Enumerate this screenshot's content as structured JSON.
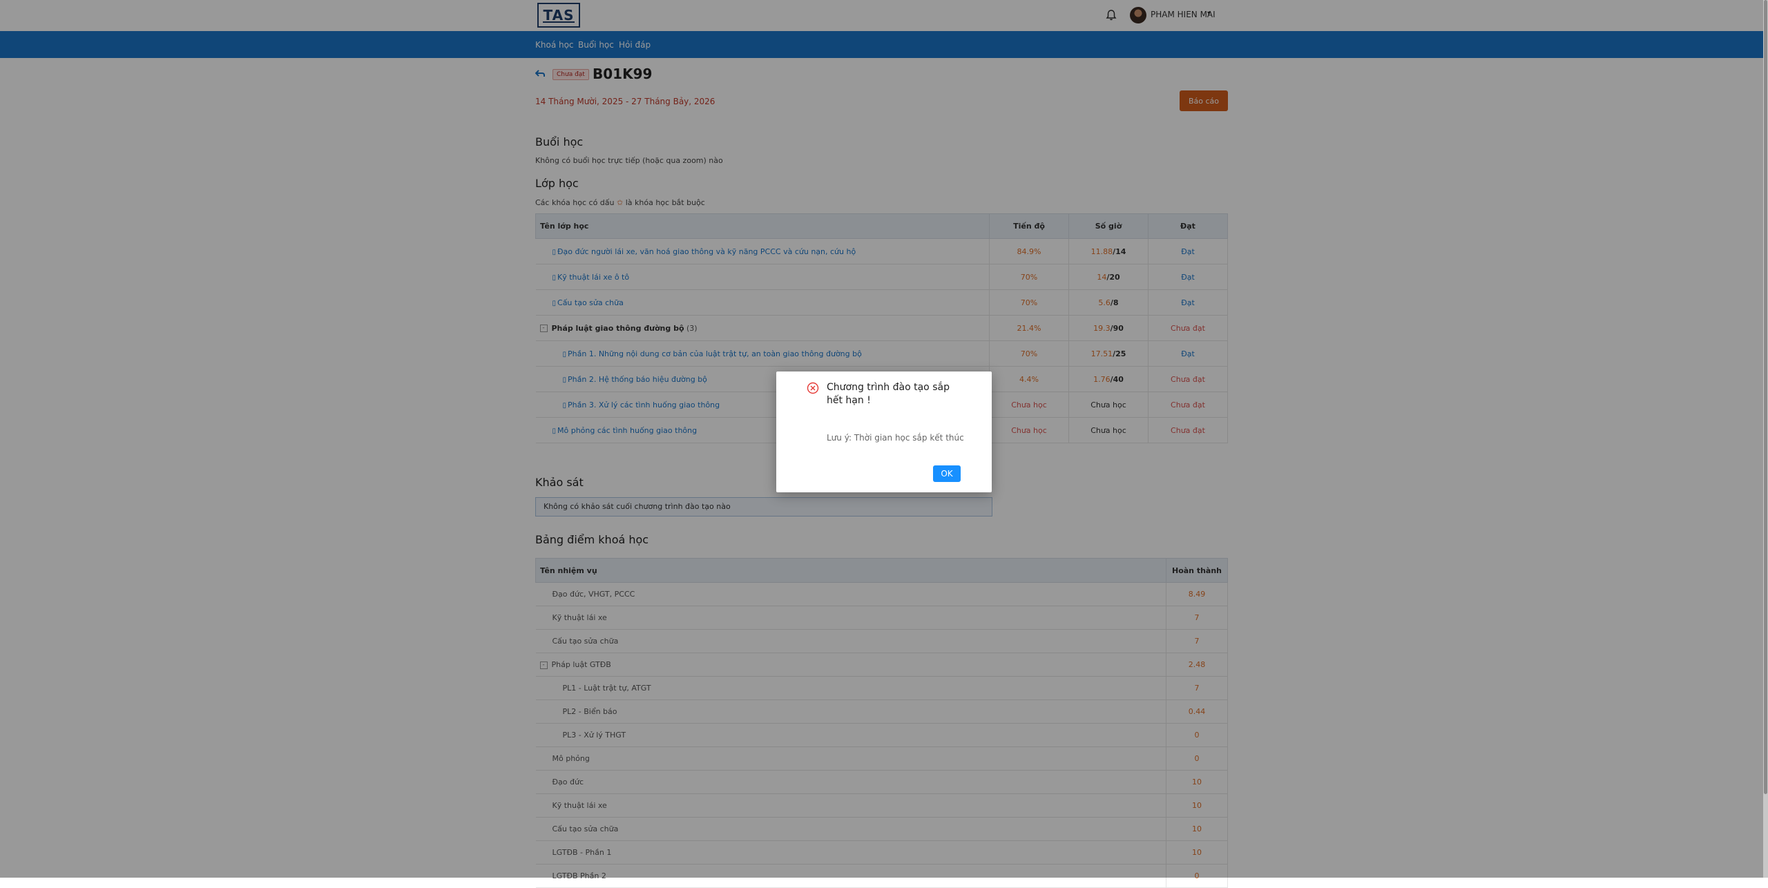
{
  "header": {
    "logo_text": "TAS",
    "user_name": "PHAM HIEN MAI",
    "caret": "▾"
  },
  "nav": {
    "items": [
      {
        "label": "Khoá học"
      },
      {
        "label": "Buổi học"
      },
      {
        "label": "Hỏi đáp"
      }
    ]
  },
  "course": {
    "status": "Chưa đạt",
    "code": "B01K99",
    "date_range": "14 Tháng Mười, 2025 - 27 Tháng Bảy, 2026",
    "report_label": "Báo cáo"
  },
  "sessions": {
    "title": "Buổi học",
    "note": "Không có buổi học trực tiếp (hoặc qua zoom) nào"
  },
  "classes": {
    "title": "Lớp học",
    "note_prefix": "Các khóa học có dấu",
    "note_mark": "✩",
    "note_suffix": "là khóa học bắt buộc",
    "headers": {
      "name": "Tên lớp học",
      "progress": "Tiến độ",
      "hours": "Số giờ",
      "passed": "Đạt"
    },
    "rows": [
      {
        "name": "Đạo đức người lái xe, văn hoá giao thông và kỹ năng PCCC và cứu nạn, cứu hộ",
        "progress": "84.9%",
        "hours_done": "11.88",
        "hours_total": "/14",
        "result": "Đạt"
      },
      {
        "name": "Kỹ thuật lái xe ô tô",
        "progress": "70%",
        "hours_done": "14",
        "hours_total": "/20",
        "result": "Đạt"
      },
      {
        "name": "Cấu tạo sửa chữa",
        "progress": "70%",
        "hours_done": "5.6",
        "hours_total": "/8",
        "result": "Đạt"
      },
      {
        "name": "Pháp luật giao thông đường bộ",
        "count": "(3)",
        "progress": "21.4%",
        "hours_done": "19.3",
        "hours_total": "/90",
        "result": "Chưa đạt"
      },
      {
        "name": "Phần 1. Những nội dung cơ bản của luật trật tự, an toàn giao thông đường bộ",
        "progress": "70%",
        "hours_done": "17.51",
        "hours_total": "/25",
        "result": "Đạt"
      },
      {
        "name": "Phần 2. Hệ thống báo hiệu đường bộ",
        "progress": "4.4%",
        "hours_done": "1.76",
        "hours_total": "/40",
        "result": "Chưa đạt"
      },
      {
        "name": "Phần 3. Xử lý các tình huống giao thông",
        "progress": "Chưa học",
        "hours": "Chưa học",
        "result": "Chưa đạt"
      },
      {
        "name": "Mô phỏng các tình huống giao thông",
        "progress": "Chưa học",
        "hours": "Chưa học",
        "result": "Chưa đạt"
      }
    ]
  },
  "survey": {
    "title": "Khảo sát",
    "note": "Không có khảo sát cuối chương trình đào tạo nào"
  },
  "scores": {
    "title": "Bảng điểm khoá học",
    "headers": {
      "task": "Tên nhiệm vụ",
      "done": "Hoàn thành"
    },
    "rows": [
      {
        "task": "Đạo đức, VHGT, PCCC",
        "score": "8.49"
      },
      {
        "task": "Kỹ thuật lái xe",
        "score": "7"
      },
      {
        "task": "Cấu tạo sửa chữa",
        "score": "7"
      },
      {
        "task": "Pháp luật GTĐB",
        "score": "2.48"
      },
      {
        "task": "PL1 - Luật trật tự, ATGT",
        "score": "7"
      },
      {
        "task": "PL2 - Biển báo",
        "score": "0.44"
      },
      {
        "task": "PL3 - Xử lý THGT",
        "score": "0"
      },
      {
        "task": "Mô phỏng",
        "score": "0"
      },
      {
        "task": "Đạo đức",
        "score": "10"
      },
      {
        "task": "Kỹ thuật lái xe",
        "score": "10"
      },
      {
        "task": "Cấu tạo sửa chữa",
        "score": "10"
      },
      {
        "task": "LGTĐB - Phần 1",
        "score": "10"
      },
      {
        "task": "LGTĐB Phần 2",
        "score": "0"
      }
    ]
  },
  "modal": {
    "title": "Chương trình đào tạo sắp hết hạn !",
    "message": "Lưu ý: Thời gian học sắp kết thúc",
    "ok_label": "OK"
  }
}
